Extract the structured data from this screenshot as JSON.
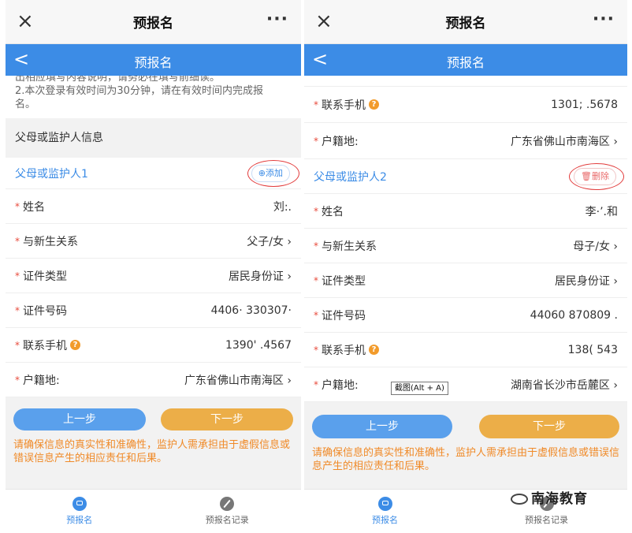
{
  "wechat": {
    "close": "×",
    "title": "预报名",
    "more": "···"
  },
  "app": {
    "back": "<",
    "title": "预报名"
  },
  "left": {
    "notice": [
      "出相应填写内容说明，请务必在填写前细读。",
      "2.本次登录有效时间为30分钟，请在有效时间内完成报",
      "名。"
    ],
    "section": "父母或监护人信息",
    "guardian_title": "父母或监护人1",
    "add_button": "⊕添加",
    "fields": [
      {
        "label": "姓名",
        "value": "刘:.",
        "help": false
      },
      {
        "label": "与新生关系",
        "value": "父子/女 ›",
        "help": false
      },
      {
        "label": "证件类型",
        "value": "居民身份证 ›",
        "help": false
      },
      {
        "label": "证件号码",
        "value": "4406·      330307·",
        "help": false
      },
      {
        "label": "联系手机",
        "value": "1390'  .4567",
        "help": true
      },
      {
        "label": "户籍地:",
        "value": "广东省佛山市南海区 ›",
        "help": false
      }
    ],
    "prev": "上一步",
    "next": "下一步",
    "warning": "请确保信息的真实性和准确性，监护人需承担由于虚假信息或错误信息产生的相应责任和后果。"
  },
  "right": {
    "top_fields": [
      {
        "label": "联系手机",
        "value": "1301;  .5678",
        "help": true
      },
      {
        "label": "户籍地:",
        "value": "广东省佛山市南海区 ›",
        "help": false
      }
    ],
    "guardian_title": "父母或监护人2",
    "delete_button": "🗑删除",
    "fields": [
      {
        "label": "姓名",
        "value": "李·’.和",
        "help": false
      },
      {
        "label": "与新生关系",
        "value": "母子/女 ›",
        "help": false
      },
      {
        "label": "证件类型",
        "value": "居民身份证 ›",
        "help": false
      },
      {
        "label": "证件号码",
        "value": "44060     870809    .",
        "help": false
      },
      {
        "label": "联系手机",
        "value": "138(        543",
        "help": true
      },
      {
        "label": "户籍地:",
        "value": "湖南省长沙市岳麓区 ›",
        "help": false
      }
    ],
    "prev": "上一步",
    "next": "下一步",
    "warning": "请确保信息的真实性和准确性，监护人需承担由于虚假信息或错误信息产生的相应责任和后果。"
  },
  "tabs": [
    {
      "label": "预报名",
      "active": true
    },
    {
      "label": "预报名记录",
      "active": false
    }
  ],
  "tooltip": "截图(Alt + A)",
  "watermark": "南海教育",
  "colors": {
    "primary": "#3c8ce6",
    "next": "#ecae48",
    "warn": "#f08a28",
    "required": "#e84c3d"
  }
}
